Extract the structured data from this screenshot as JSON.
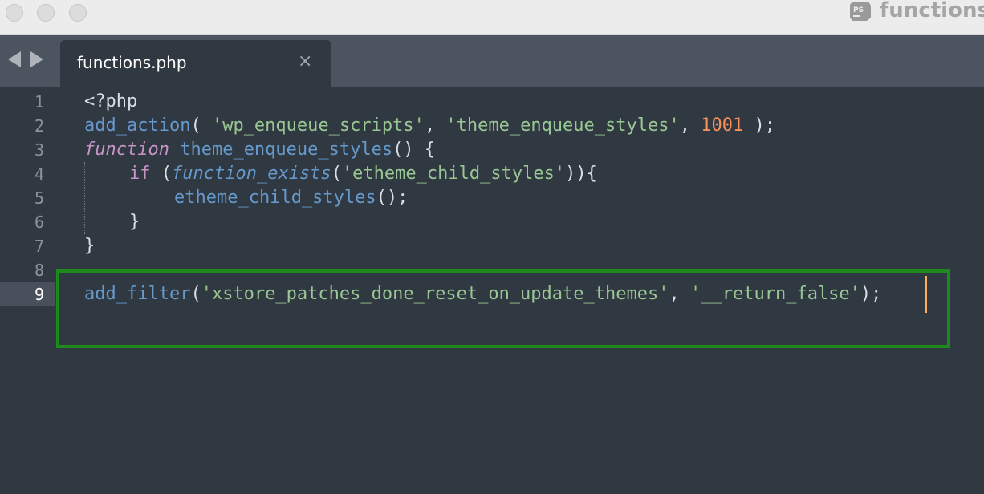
{
  "window": {
    "title": "functions.",
    "app_icon": "ps-icon",
    "traffic_lights": [
      "close",
      "minimize",
      "zoom"
    ]
  },
  "tabs": {
    "active_label": "functions.php",
    "close_icon": "×"
  },
  "editor": {
    "current_line": 9,
    "line_numbers": [
      "1",
      "2",
      "3",
      "4",
      "5",
      "6",
      "7",
      "8",
      "9"
    ],
    "lines": {
      "l1": {
        "t1": "<?php"
      },
      "l2": {
        "t1": "add_action",
        "t2": "( ",
        "t3": "'wp_enqueue_scripts'",
        "t4": ", ",
        "t5": "'theme_enqueue_styles'",
        "t6": ", ",
        "t7": "1001",
        "t8": " );"
      },
      "l3": {
        "t1": "function",
        "t2": " ",
        "t3": "theme_enqueue_styles",
        "t4": "() {"
      },
      "l4": {
        "t1": "if",
        "t2": " (",
        "t3": "function_exists",
        "t4": "(",
        "t5": "'etheme_child_styles'",
        "t6": ")){"
      },
      "l5": {
        "t1": "etheme_child_styles",
        "t2": "();"
      },
      "l6": {
        "t1": "}"
      },
      "l7": {
        "t1": "}"
      },
      "l8": {},
      "l9": {
        "t1": "add_filter",
        "t2": "(",
        "t3": "'xstore_patches_done_reset_on_update_themes'",
        "t4": ", ",
        "t5": "'__return_false'",
        "t6": ");"
      }
    }
  },
  "colors": {
    "editor_bg": "#303841",
    "tabbar_bg": "#4c555f",
    "function_blue": "#6699cc",
    "string_green": "#99c794",
    "number_orange": "#f99157",
    "keyword_purple": "#c594c5",
    "caret": "#f9ae58",
    "highlight_box": "#1e8a1e"
  }
}
